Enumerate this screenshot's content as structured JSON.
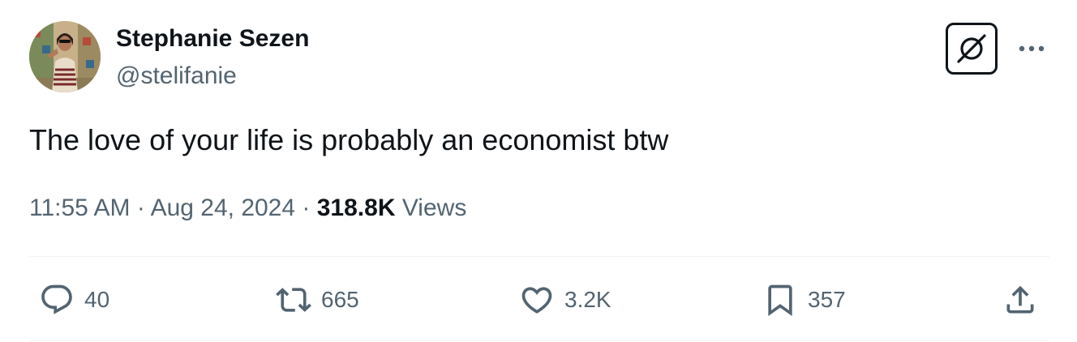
{
  "author": {
    "name": "Stephanie Sezen",
    "handle": "@stelifanie"
  },
  "tweet": {
    "text": "The love of your life is probably an economist btw",
    "time": "11:55 AM",
    "date": "Aug 24, 2024",
    "separator": "·",
    "views_count": "318.8K",
    "views_label": "Views"
  },
  "actions": {
    "replies": "40",
    "reposts": "665",
    "likes": "3.2K",
    "bookmarks": "357"
  },
  "icons": {
    "grok": "grok-icon",
    "more": "more-icon",
    "reply": "reply-icon",
    "retweet": "retweet-icon",
    "like": "heart-icon",
    "bookmark": "bookmark-icon",
    "share": "share-icon"
  },
  "colors": {
    "text_primary": "#0f1419",
    "text_secondary": "#536471",
    "divider": "#eff3f4"
  }
}
